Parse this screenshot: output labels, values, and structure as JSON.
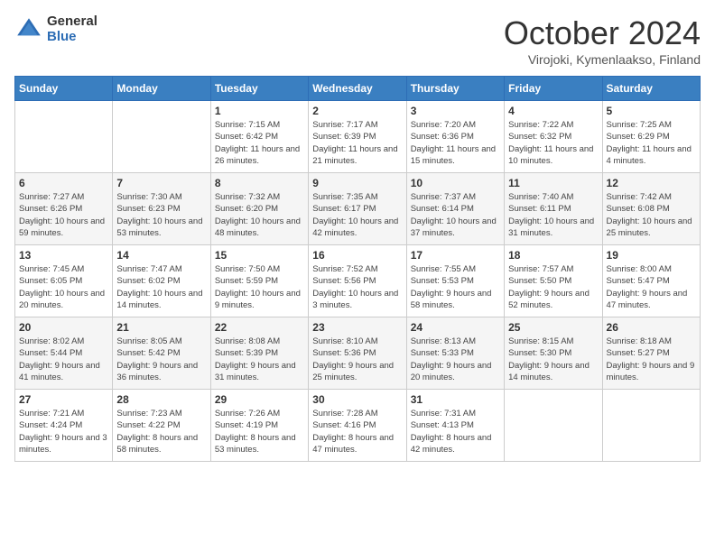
{
  "header": {
    "logo_general": "General",
    "logo_blue": "Blue",
    "month": "October 2024",
    "location": "Virojoki, Kymenlaakso, Finland"
  },
  "days_of_week": [
    "Sunday",
    "Monday",
    "Tuesday",
    "Wednesday",
    "Thursday",
    "Friday",
    "Saturday"
  ],
  "weeks": [
    [
      {
        "day": "",
        "sunrise": "",
        "sunset": "",
        "daylight": ""
      },
      {
        "day": "",
        "sunrise": "",
        "sunset": "",
        "daylight": ""
      },
      {
        "day": "1",
        "sunrise": "Sunrise: 7:15 AM",
        "sunset": "Sunset: 6:42 PM",
        "daylight": "Daylight: 11 hours and 26 minutes."
      },
      {
        "day": "2",
        "sunrise": "Sunrise: 7:17 AM",
        "sunset": "Sunset: 6:39 PM",
        "daylight": "Daylight: 11 hours and 21 minutes."
      },
      {
        "day": "3",
        "sunrise": "Sunrise: 7:20 AM",
        "sunset": "Sunset: 6:36 PM",
        "daylight": "Daylight: 11 hours and 15 minutes."
      },
      {
        "day": "4",
        "sunrise": "Sunrise: 7:22 AM",
        "sunset": "Sunset: 6:32 PM",
        "daylight": "Daylight: 11 hours and 10 minutes."
      },
      {
        "day": "5",
        "sunrise": "Sunrise: 7:25 AM",
        "sunset": "Sunset: 6:29 PM",
        "daylight": "Daylight: 11 hours and 4 minutes."
      }
    ],
    [
      {
        "day": "6",
        "sunrise": "Sunrise: 7:27 AM",
        "sunset": "Sunset: 6:26 PM",
        "daylight": "Daylight: 10 hours and 59 minutes."
      },
      {
        "day": "7",
        "sunrise": "Sunrise: 7:30 AM",
        "sunset": "Sunset: 6:23 PM",
        "daylight": "Daylight: 10 hours and 53 minutes."
      },
      {
        "day": "8",
        "sunrise": "Sunrise: 7:32 AM",
        "sunset": "Sunset: 6:20 PM",
        "daylight": "Daylight: 10 hours and 48 minutes."
      },
      {
        "day": "9",
        "sunrise": "Sunrise: 7:35 AM",
        "sunset": "Sunset: 6:17 PM",
        "daylight": "Daylight: 10 hours and 42 minutes."
      },
      {
        "day": "10",
        "sunrise": "Sunrise: 7:37 AM",
        "sunset": "Sunset: 6:14 PM",
        "daylight": "Daylight: 10 hours and 37 minutes."
      },
      {
        "day": "11",
        "sunrise": "Sunrise: 7:40 AM",
        "sunset": "Sunset: 6:11 PM",
        "daylight": "Daylight: 10 hours and 31 minutes."
      },
      {
        "day": "12",
        "sunrise": "Sunrise: 7:42 AM",
        "sunset": "Sunset: 6:08 PM",
        "daylight": "Daylight: 10 hours and 25 minutes."
      }
    ],
    [
      {
        "day": "13",
        "sunrise": "Sunrise: 7:45 AM",
        "sunset": "Sunset: 6:05 PM",
        "daylight": "Daylight: 10 hours and 20 minutes."
      },
      {
        "day": "14",
        "sunrise": "Sunrise: 7:47 AM",
        "sunset": "Sunset: 6:02 PM",
        "daylight": "Daylight: 10 hours and 14 minutes."
      },
      {
        "day": "15",
        "sunrise": "Sunrise: 7:50 AM",
        "sunset": "Sunset: 5:59 PM",
        "daylight": "Daylight: 10 hours and 9 minutes."
      },
      {
        "day": "16",
        "sunrise": "Sunrise: 7:52 AM",
        "sunset": "Sunset: 5:56 PM",
        "daylight": "Daylight: 10 hours and 3 minutes."
      },
      {
        "day": "17",
        "sunrise": "Sunrise: 7:55 AM",
        "sunset": "Sunset: 5:53 PM",
        "daylight": "Daylight: 9 hours and 58 minutes."
      },
      {
        "day": "18",
        "sunrise": "Sunrise: 7:57 AM",
        "sunset": "Sunset: 5:50 PM",
        "daylight": "Daylight: 9 hours and 52 minutes."
      },
      {
        "day": "19",
        "sunrise": "Sunrise: 8:00 AM",
        "sunset": "Sunset: 5:47 PM",
        "daylight": "Daylight: 9 hours and 47 minutes."
      }
    ],
    [
      {
        "day": "20",
        "sunrise": "Sunrise: 8:02 AM",
        "sunset": "Sunset: 5:44 PM",
        "daylight": "Daylight: 9 hours and 41 minutes."
      },
      {
        "day": "21",
        "sunrise": "Sunrise: 8:05 AM",
        "sunset": "Sunset: 5:42 PM",
        "daylight": "Daylight: 9 hours and 36 minutes."
      },
      {
        "day": "22",
        "sunrise": "Sunrise: 8:08 AM",
        "sunset": "Sunset: 5:39 PM",
        "daylight": "Daylight: 9 hours and 31 minutes."
      },
      {
        "day": "23",
        "sunrise": "Sunrise: 8:10 AM",
        "sunset": "Sunset: 5:36 PM",
        "daylight": "Daylight: 9 hours and 25 minutes."
      },
      {
        "day": "24",
        "sunrise": "Sunrise: 8:13 AM",
        "sunset": "Sunset: 5:33 PM",
        "daylight": "Daylight: 9 hours and 20 minutes."
      },
      {
        "day": "25",
        "sunrise": "Sunrise: 8:15 AM",
        "sunset": "Sunset: 5:30 PM",
        "daylight": "Daylight: 9 hours and 14 minutes."
      },
      {
        "day": "26",
        "sunrise": "Sunrise: 8:18 AM",
        "sunset": "Sunset: 5:27 PM",
        "daylight": "Daylight: 9 hours and 9 minutes."
      }
    ],
    [
      {
        "day": "27",
        "sunrise": "Sunrise: 7:21 AM",
        "sunset": "Sunset: 4:24 PM",
        "daylight": "Daylight: 9 hours and 3 minutes."
      },
      {
        "day": "28",
        "sunrise": "Sunrise: 7:23 AM",
        "sunset": "Sunset: 4:22 PM",
        "daylight": "Daylight: 8 hours and 58 minutes."
      },
      {
        "day": "29",
        "sunrise": "Sunrise: 7:26 AM",
        "sunset": "Sunset: 4:19 PM",
        "daylight": "Daylight: 8 hours and 53 minutes."
      },
      {
        "day": "30",
        "sunrise": "Sunrise: 7:28 AM",
        "sunset": "Sunset: 4:16 PM",
        "daylight": "Daylight: 8 hours and 47 minutes."
      },
      {
        "day": "31",
        "sunrise": "Sunrise: 7:31 AM",
        "sunset": "Sunset: 4:13 PM",
        "daylight": "Daylight: 8 hours and 42 minutes."
      },
      {
        "day": "",
        "sunrise": "",
        "sunset": "",
        "daylight": ""
      },
      {
        "day": "",
        "sunrise": "",
        "sunset": "",
        "daylight": ""
      }
    ]
  ]
}
